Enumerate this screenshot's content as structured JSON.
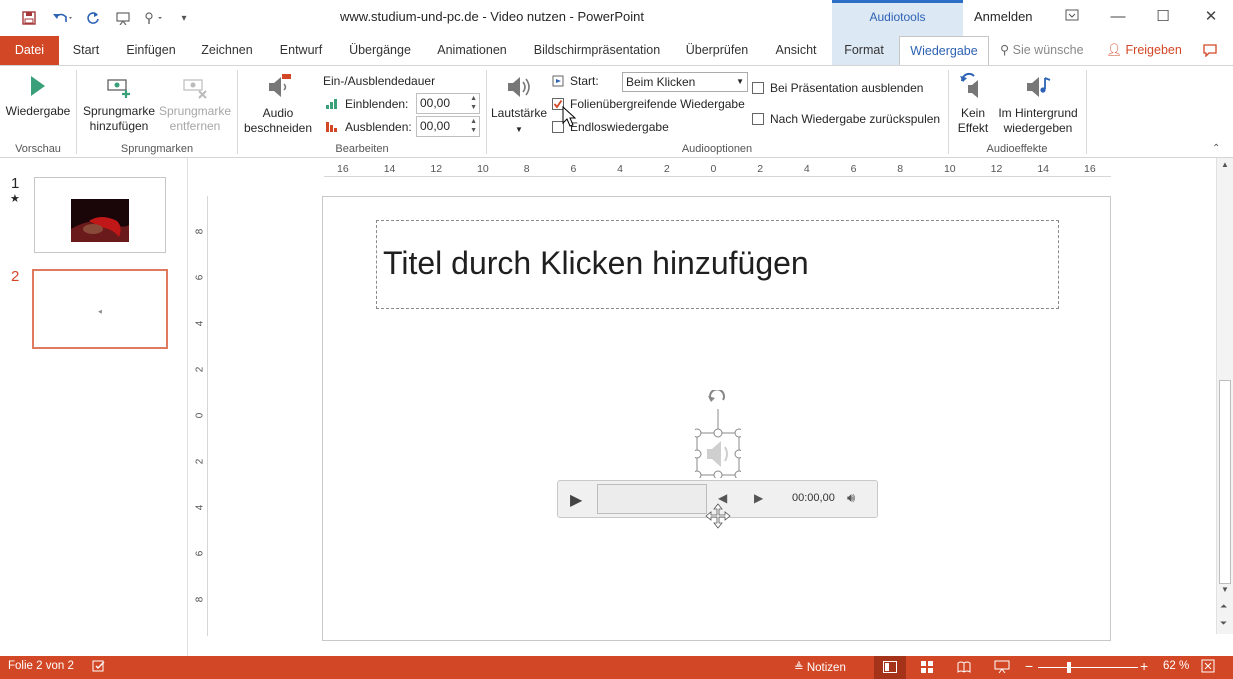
{
  "titlebar": {
    "title": "www.studium-und-pc.de - Video nutzen  -  PowerPoint",
    "context_header": "Audiotools",
    "signin": "Anmelden",
    "save_icon": "save-icon",
    "undo_icon": "undo-icon",
    "redo_icon": "repeat-icon"
  },
  "tabs": {
    "file": "Datei",
    "start": "Start",
    "insert": "Einfügen",
    "draw": "Zeichnen",
    "design": "Entwurf",
    "transitions": "Übergänge",
    "animations": "Animationen",
    "slideshow": "Bildschirmpräsentation",
    "review": "Überprüfen",
    "view": "Ansicht",
    "format": "Format",
    "playback": "Wiedergabe",
    "tellme": "Sie wünsche",
    "share": "Freigeben"
  },
  "ribbon": {
    "preview": {
      "play": "Wiedergabe",
      "group": "Vorschau"
    },
    "bookmarks": {
      "add_l1": "Sprungmarke",
      "add_l2": "hinzufügen",
      "remove_l1": "Sprungmarke",
      "remove_l2": "entfernen",
      "group": "Sprungmarken"
    },
    "editing": {
      "trim_l1": "Audio",
      "trim_l2": "beschneiden",
      "fade_title": "Ein-/Ausblendedauer",
      "fade_in_label": "Einblenden:",
      "fade_in_value": "00,00",
      "fade_out_label": "Ausblenden:",
      "fade_out_value": "00,00",
      "group": "Bearbeiten"
    },
    "audio_options": {
      "volume": "Lautstärke",
      "start_label": "Start:",
      "start_value": "Beim Klicken",
      "play_across": "Folienübergreifende Wiedergabe",
      "play_across_checked": true,
      "loop": "Endloswiedergabe",
      "loop_checked": false,
      "hide": "Bei Präsentation ausblenden",
      "hide_checked": false,
      "rewind": "Nach Wiedergabe zurückspulen",
      "rewind_checked": false,
      "group": "Audiooptionen"
    },
    "audio_styles": {
      "no_style_l1": "Kein",
      "no_style_l2": "Effekt",
      "bg_l1": "Im Hintergrund",
      "bg_l2": "wiedergeben",
      "group": "Audioeffekte"
    }
  },
  "thumbnails": [
    {
      "num": "1",
      "star": "★"
    },
    {
      "num": "2",
      "star": ""
    }
  ],
  "ruler": {
    "h_ticks": [
      "16",
      "14",
      "12",
      "10",
      "8",
      "6",
      "4",
      "2",
      "0",
      "2",
      "4",
      "6",
      "8",
      "10",
      "12",
      "14",
      "16"
    ],
    "v_ticks": [
      "8",
      "6",
      "4",
      "2",
      "0",
      "2",
      "4",
      "6",
      "8"
    ]
  },
  "slide": {
    "title_placeholder": "Titel durch Klicken hinzufügen",
    "player_time": "00:00,00"
  },
  "status": {
    "slide_info": "Folie 2 von 2",
    "notes": "Notizen",
    "zoom": "62 %",
    "zoom_fraction": 0.62
  },
  "colors": {
    "accent": "#d24726",
    "context": "#2d62b4"
  }
}
